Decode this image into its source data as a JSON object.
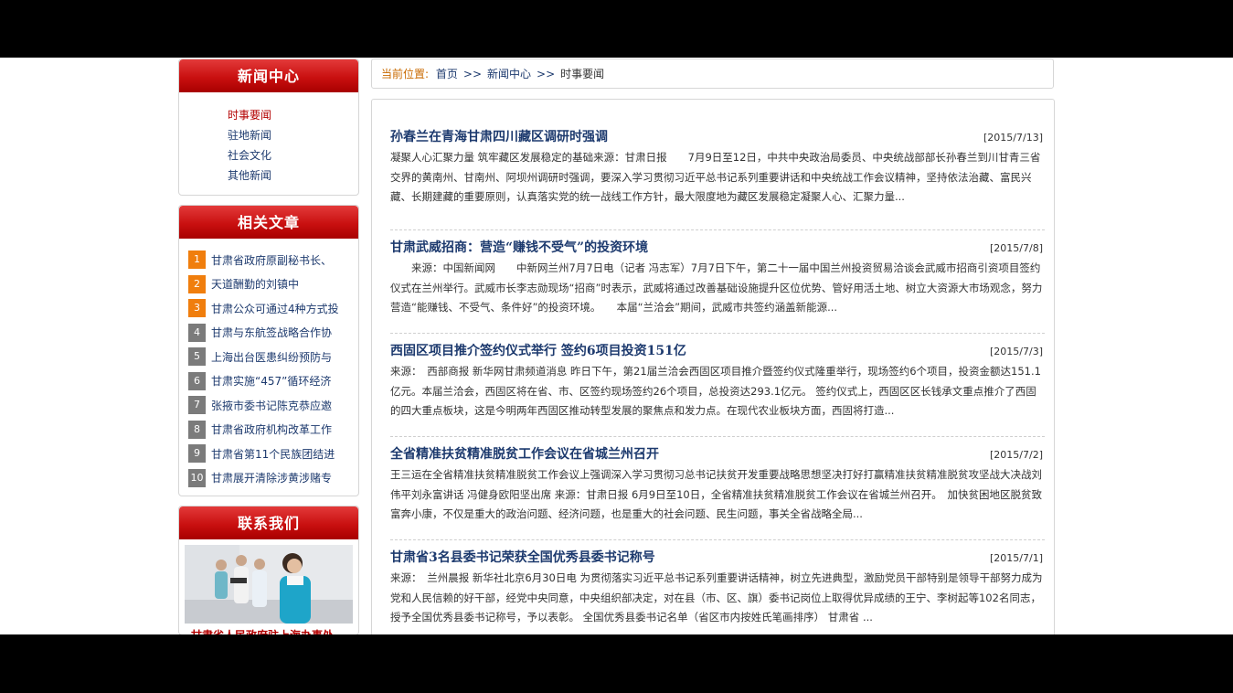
{
  "sidebar": {
    "news_center_title": "新闻中心",
    "nav_items": [
      "时事要闻",
      "驻地新闻",
      "社会文化",
      "其他新闻"
    ],
    "related_title": "相关文章",
    "related_items": [
      {
        "num": "1",
        "text": "甘肃省政府原副秘书长、"
      },
      {
        "num": "2",
        "text": "天道酬勤的刘镇中"
      },
      {
        "num": "3",
        "text": "甘肃公众可通过4种方式投"
      },
      {
        "num": "4",
        "text": "甘肃与东航签战略合作协"
      },
      {
        "num": "5",
        "text": "上海出台医患纠纷预防与"
      },
      {
        "num": "6",
        "text": "甘肃实施“457”循环经济"
      },
      {
        "num": "7",
        "text": "张掖市委书记陈克恭应邀"
      },
      {
        "num": "8",
        "text": "甘肃省政府机构改革工作"
      },
      {
        "num": "9",
        "text": "甘肃省第11个民族团结进"
      },
      {
        "num": "10",
        "text": "甘肃展开清除涉黄涉赌专"
      }
    ],
    "contact_title": "联系我们",
    "contact_caption": "甘肃省人民政府驻上海办事处"
  },
  "breadcrumb": {
    "label": "当前位置:",
    "home": "首页",
    "sep": ">>",
    "section": "新闻中心",
    "current": "时事要闻"
  },
  "articles": [
    {
      "title": "孙春兰在青海甘肃四川藏区调研时强调",
      "date": "[2015/7/13]",
      "summary": "凝聚人心汇聚力量 筑牢藏区发展稳定的基础来源：甘肃日报　　7月9日至12日，中共中央政治局委员、中央统战部部长孙春兰到川甘青三省交界的黄南州、甘南州、阿坝州调研时强调，要深入学习贯彻习近平总书记系列重要讲话和中央统战工作会议精神，坚持依法治藏、富民兴藏、长期建藏的重要原则，认真落实党的统一战线工作方针，最大限度地为藏区发展稳定凝聚人心、汇聚力量..."
    },
    {
      "title": "甘肃武威招商：营造“赚钱不受气”的投资环境",
      "date": "[2015/7/8]",
      "summary": "　　来源：中国新闻网　　中新网兰州7月7日电（记者 冯志军）7月7日下午，第二十一届中国兰州投资贸易洽谈会武威市招商引资项目签约仪式在兰州举行。武威市长李志勋现场“招商”时表示，武威将通过改善基础设施提升区位优势、管好用活土地、树立大资源大市场观念，努力营造“能赚钱、不受气、条件好”的投资环境。　　本届“兰洽会”期间，武威市共签约涵盖新能源..."
    },
    {
      "title": "西固区项目推介签约仪式举行 签约6项目投资151亿",
      "date": "[2015/7/3]",
      "summary": "来源：　西部商报 新华网甘肃频道消息 昨日下午，第21届兰洽会西固区项目推介暨签约仪式隆重举行，现场签约6个项目，投资金额达151.1亿元。本届兰洽会，西固区将在省、市、区签约现场签约26个项目，总投资达293.1亿元。 签约仪式上，西固区区长钱承文重点推介了西固的四大重点板块，这是今明两年西固区推动转型发展的聚焦点和发力点。在现代农业板块方面，西固将打造..."
    },
    {
      "title": "全省精准扶贫精准脱贫工作会议在省城兰州召开",
      "date": "[2015/7/2]",
      "summary": "王三运在全省精准扶贫精准脱贫工作会议上强调深入学习贯彻习总书记扶贫开发重要战略思想坚决打好打赢精准扶贫精准脱贫攻坚战大决战刘伟平刘永富讲话 冯健身欧阳坚出席 来源：甘肃日报 6月9日至10日，全省精准扶贫精准脱贫工作会议在省城兰州召开。　加快贫困地区脱贫致富奔小康，不仅是重大的政治问题、经济问题，也是重大的社会问题、民生问题，事关全省战略全局..."
    },
    {
      "title": "甘肃省3名县委书记荣获全国优秀县委书记称号",
      "date": "[2015/7/1]",
      "summary": "来源：　兰州晨报 新华社北京6月30日电 为贯彻落实习近平总书记系列重要讲话精神，树立先进典型，激励党员干部特别是领导干部努力成为党和人民信赖的好干部，经党中央同意，中央组织部决定，对在县（市、区、旗）委书记岗位上取得优异成绩的王宁、李树起等102名同志，授予全国优秀县委书记称号，予以表彰。 全国优秀县委书记名单（省区市内按姓氏笔画排序） 甘肃省 ..."
    }
  ],
  "colors": {
    "accent_red": "#c91010",
    "link_blue": "#1d3a6e",
    "hot_orange": "#f07e0d",
    "num_gray": "#7b7b7b"
  }
}
